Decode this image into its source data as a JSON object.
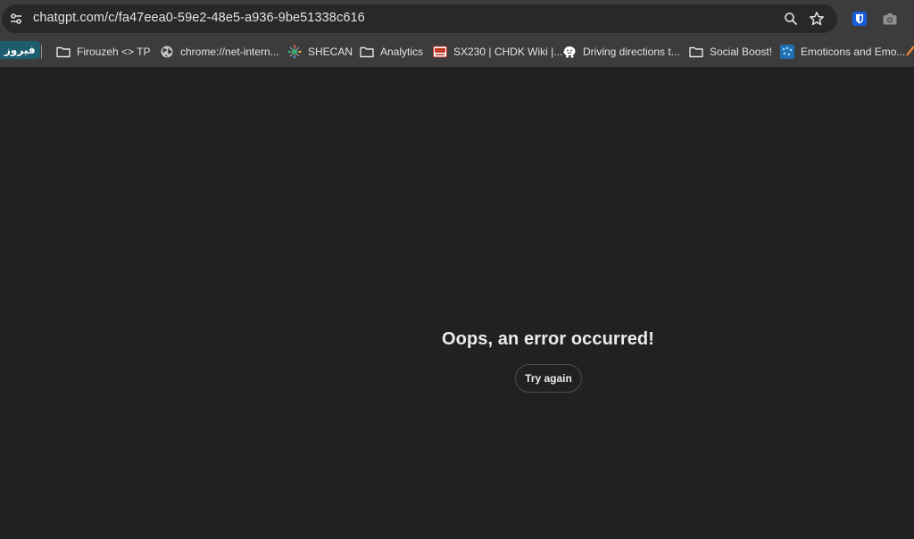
{
  "browser": {
    "url": "chatgpt.com/c/fa47eea0-59e2-48e5-a936-9be51338c616",
    "bookmarks": [
      {
        "label": "فیروز",
        "icon": "persian-chip"
      },
      {
        "label": "Firouzeh <> TP",
        "icon": "folder-icon"
      },
      {
        "label": "chrome://net-intern...",
        "icon": "globe-icon"
      },
      {
        "label": "SHECAN",
        "icon": "shecan-icon"
      },
      {
        "label": "Analytics",
        "icon": "folder-icon"
      },
      {
        "label": "SX230 | CHDK Wiki |...",
        "icon": "chdk-icon"
      },
      {
        "label": "Driving directions t...",
        "icon": "waze-icon"
      },
      {
        "label": "Social Boost!",
        "icon": "folder-icon"
      },
      {
        "label": "Emoticons and Emo...",
        "icon": "emoticons-site-icon"
      }
    ]
  },
  "page": {
    "error_title": "Oops, an error occurred!",
    "retry_label": "Try again"
  },
  "colors": {
    "background": "#212121",
    "toolbar": "#3c3c3c",
    "omnibox": "#282828",
    "bitwarden": "#175ddc"
  }
}
